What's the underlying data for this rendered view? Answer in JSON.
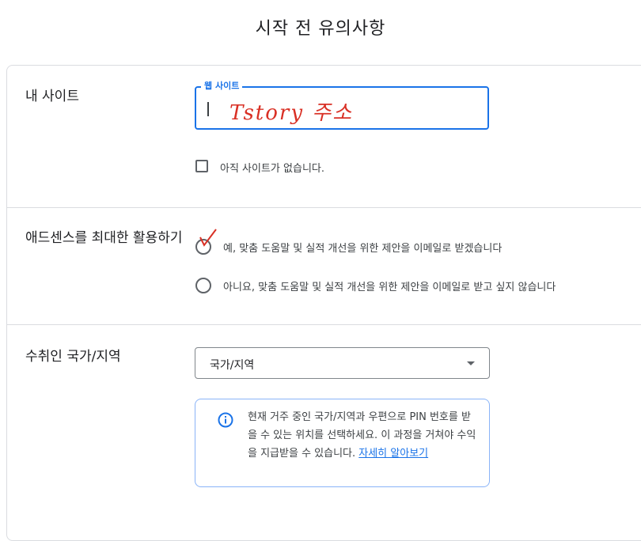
{
  "page": {
    "title": "시작 전 유의사항"
  },
  "site_section": {
    "label": "내 사이트",
    "field_label": "웹 사이트",
    "handwritten_value": "Tstory 주소",
    "no_site_checkbox_label": "아직 사이트가 없습니다."
  },
  "adsense_section": {
    "label": "애드센스를 최대한 활용하기",
    "options": [
      {
        "label": "예, 맞춤 도움말 및 실적 개선을 위한 제안을 이메일로 받겠습니다"
      },
      {
        "label": "아니요, 맞춤 도움말 및 실적 개선을 위한 제안을 이메일로 받고 싶지 않습니다"
      }
    ]
  },
  "country_section": {
    "label": "수취인 국가/지역",
    "select_value": "국가/지역",
    "info_text": "현재 거주 중인 국가/지역과 우편으로 PIN 번호를 받을 수 있는 위치를 선택하세요. 이 과정을 거쳐야 수익을 지급받을 수 있습니다. ",
    "info_link": "자세히 알아보기"
  },
  "colors": {
    "accent": "#1a73e8",
    "annotation": "#d93025",
    "border": "#dadce0"
  }
}
